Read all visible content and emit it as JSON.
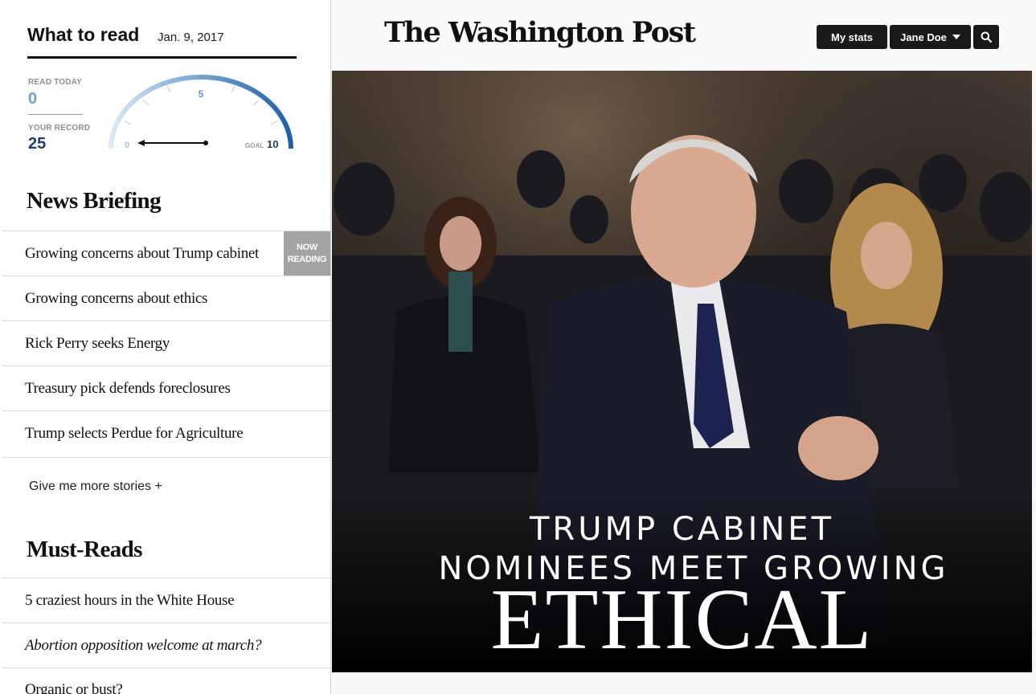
{
  "sidebar": {
    "what_to_read": {
      "title": "What to read",
      "date": "Jan. 9, 2017"
    },
    "stats": {
      "read_today_label": "READ TODAY",
      "read_today_value": "0",
      "record_label": "YOUR RECORD",
      "record_value": "25",
      "gauge": {
        "min_label": "0",
        "mid_label": "5",
        "goal_label": "GOAL",
        "goal_value": "10",
        "current": 0,
        "max": 10
      }
    },
    "news_briefing": {
      "title": "News Briefing",
      "items": [
        {
          "label": "Growing concerns about Trump cabinet",
          "badge_line1": "NOW",
          "badge_line2": "READING"
        },
        {
          "label": "Growing concerns about ethics"
        },
        {
          "label": "Rick Perry seeks Energy"
        },
        {
          "label": "Treasury pick defends foreclosures"
        },
        {
          "label": "Trump selects Perdue for Agriculture"
        }
      ],
      "more_label": "Give me more stories +"
    },
    "must_reads": {
      "title": "Must-Reads",
      "items": [
        {
          "label": "5 craziest hours in the White House"
        },
        {
          "label": "Abortion opposition welcome at march?"
        },
        {
          "label": "Organic or bust?"
        }
      ]
    }
  },
  "header": {
    "logo_text": "The Washington Post",
    "my_stats_label": "My stats",
    "user_label": "Jane Doe",
    "icons": {
      "dropdown": "caret-down-icon",
      "search": "search-icon"
    }
  },
  "hero": {
    "headline_line1": "TRUMP CABINET",
    "headline_line2": "NOMINEES MEET GROWING",
    "headline_line3": "ETHICAL"
  },
  "colors": {
    "gauge_light": "#b9d3ec",
    "gauge_dark": "#1e5fa8",
    "read_today": "#6ea0d0",
    "record": "#1d3f6c",
    "badge": "#a3a3a3",
    "button": "#1a1a1a"
  }
}
